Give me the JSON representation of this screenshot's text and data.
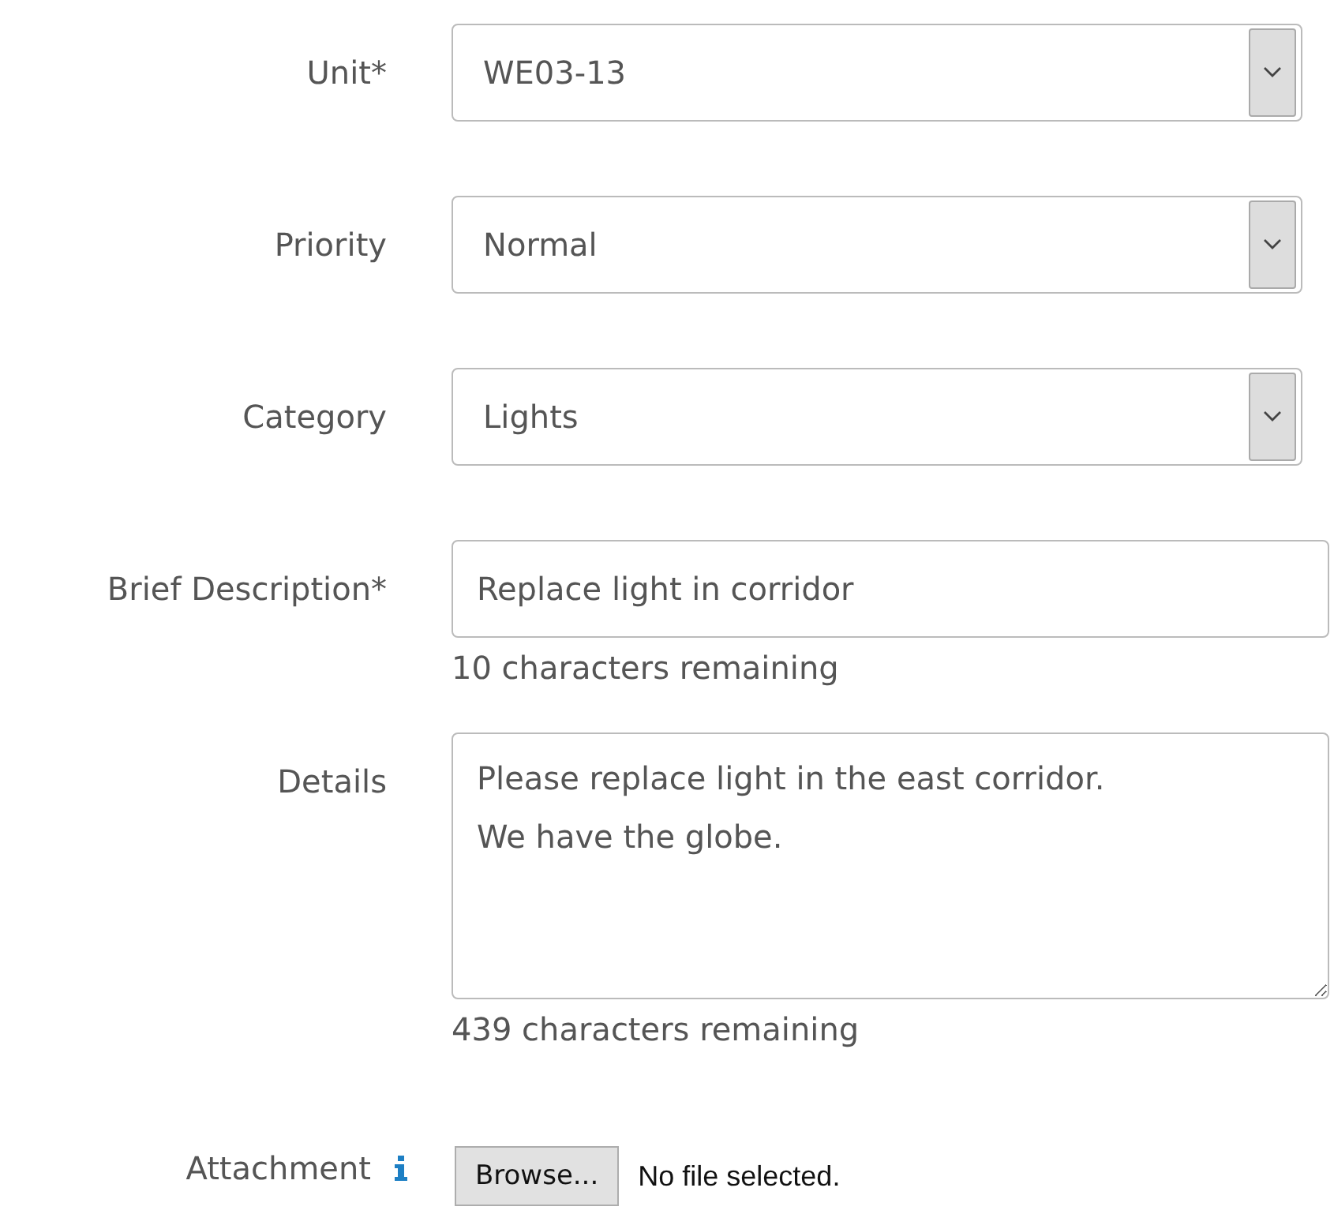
{
  "fields": [
    {
      "kind": "select",
      "label": "Unit*",
      "value": "WE03-13"
    },
    {
      "kind": "select",
      "label": "Priority",
      "value": "Normal"
    },
    {
      "kind": "select",
      "label": "Category",
      "value": "Lights"
    },
    {
      "kind": "text",
      "label": "Brief Description*",
      "value": "Replace light in corridor",
      "helper": "10 characters remaining"
    },
    {
      "kind": "textarea",
      "label": "Details",
      "value": "Please replace light in the east corridor.\nWe have the globe.",
      "helper": "439 characters remaining"
    },
    {
      "kind": "file",
      "label": "Attachment",
      "button": "Browse...",
      "status": "No file selected."
    }
  ]
}
